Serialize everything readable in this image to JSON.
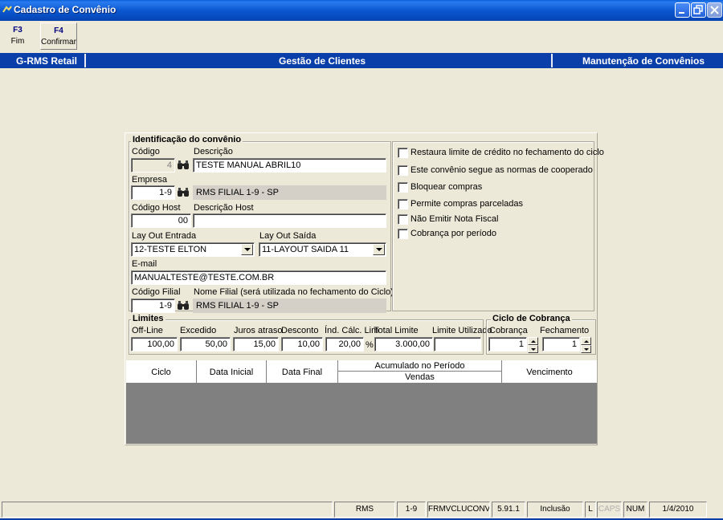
{
  "window": {
    "title": "Cadastro de Convênio"
  },
  "toolbar": {
    "fim": {
      "key": "F3",
      "label": "Fim"
    },
    "confirmar": {
      "key": "F4",
      "label": "Confirmar"
    }
  },
  "banner": {
    "left": "G-RMS Retail",
    "center": "Gestão de Clientes",
    "right": "Manutenção de Convênios"
  },
  "identificacao": {
    "title": "Identificação do convênio",
    "codigo": {
      "label": "Código",
      "value": "4"
    },
    "descricao": {
      "label": "Descrição",
      "value": "TESTE MANUAL ABRIL10"
    },
    "empresa": {
      "label": "Empresa",
      "value": "1-9",
      "name": "RMS FILIAL 1-9 - SP"
    },
    "codigo_host": {
      "label": "Código Host",
      "value": "00"
    },
    "descricao_host": {
      "label": "Descrição Host",
      "value": ""
    },
    "layout_entrada": {
      "label": "Lay Out Entrada",
      "value": "12-TESTE ELTON"
    },
    "layout_saida": {
      "label": "Lay Out Saída",
      "value": "11-LAYOUT SAIDA 11"
    },
    "email": {
      "label": "E-mail",
      "value": "MANUALTESTE@TESTE.COM.BR"
    },
    "codigo_filial": {
      "label": "Código Filial",
      "value": "1-9"
    },
    "nome_filial": {
      "label": "Nome Filial (será utilizada no fechamento do Ciclo)",
      "value": "RMS FILIAL 1-9 - SP"
    }
  },
  "options": [
    {
      "label": "Restaura limite de crédito no fechamento do ciclo",
      "checked": false
    },
    {
      "label": "Este convênio segue as normas de cooperado",
      "checked": false
    },
    {
      "label": "Bloquear compras",
      "checked": false
    },
    {
      "label": "Permite compras parceladas",
      "checked": false
    },
    {
      "label": "Não Emitir Nota Fiscal",
      "checked": false
    },
    {
      "label": "Cobrança por período",
      "checked": false
    }
  ],
  "limites": {
    "title": "Limites",
    "off_line": {
      "label": "Off-Line",
      "value": "100,00"
    },
    "excedido": {
      "label": "Excedido",
      "value": "50,00"
    },
    "juros_atraso": {
      "label": "Juros atraso",
      "value": "15,00"
    },
    "desconto": {
      "label": "Desconto",
      "value": "10,00"
    },
    "ind_calc_lim": {
      "label": "Índ. Cálc. Lim",
      "value": "20,00",
      "unit": "%"
    },
    "total_limite": {
      "label": "Total Limite",
      "value": "3.000,00"
    },
    "limite_utilizado": {
      "label": "Limite Utilizado",
      "value": ""
    }
  },
  "ciclo_cobranca": {
    "title": "Ciclo de Cobrança",
    "cobranca": {
      "label": "Cobrança",
      "value": "1"
    },
    "fechamento": {
      "label": "Fechamento",
      "value": "1"
    }
  },
  "grid": {
    "columns": [
      "Ciclo",
      "Data Inicial",
      "Data Final",
      "Vencimento"
    ],
    "group_header": "Acumulado no Período",
    "sub_column": "Vendas",
    "rows": []
  },
  "statusbar": [
    "RMS",
    "1-9",
    "FRMVCLUCONV",
    "5.91.1",
    "Inclusão",
    "L",
    "CAPS",
    "NUM",
    "1/4/2010"
  ]
}
